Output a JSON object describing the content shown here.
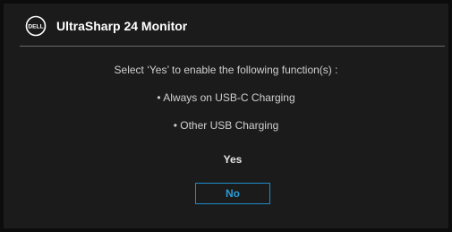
{
  "header": {
    "logo_text": "DELL",
    "title": "UltraSharp 24 Monitor"
  },
  "dialog": {
    "prompt": "Select ‘Yes’ to enable the following function(s) :",
    "features": [
      "• Always on USB-C Charging",
      "• Other USB Charging"
    ]
  },
  "buttons": {
    "yes_label": "Yes",
    "no_label": "No"
  },
  "colors": {
    "background": "#1b1b1b",
    "accent": "#2a9bd8",
    "selected_border": "#1f8ac9"
  }
}
